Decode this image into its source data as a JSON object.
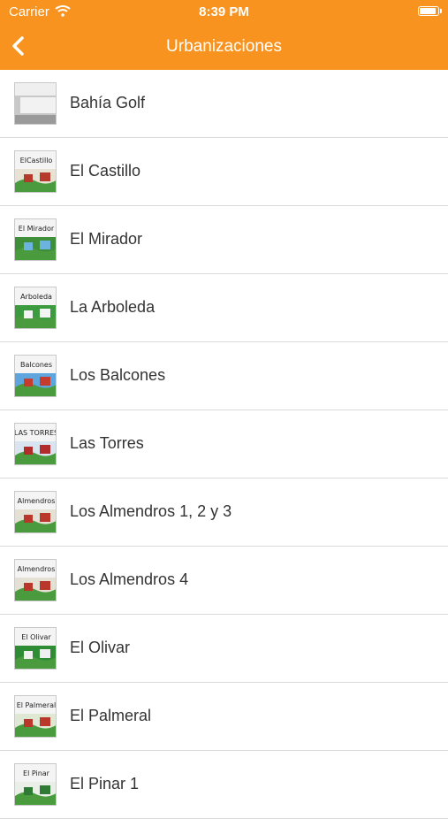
{
  "status_bar": {
    "carrier": "Carrier",
    "time": "8:39 PM"
  },
  "nav": {
    "title": "Urbanizaciones",
    "back_icon": "chevron-left-icon"
  },
  "colors": {
    "accent": "#f7931e",
    "separator": "#d9d9d9",
    "text": "#333333"
  },
  "items": [
    {
      "label": "Bahía Golf",
      "sign": "",
      "style": "photo"
    },
    {
      "label": "El Castillo",
      "sign": "ElCastillo",
      "style": "tile"
    },
    {
      "label": "El Mirador",
      "sign": "El Mirador",
      "style": "tile"
    },
    {
      "label": "La Arboleda",
      "sign": "Arboleda",
      "style": "tile"
    },
    {
      "label": "Los Balcones",
      "sign": "Balcones",
      "style": "tile"
    },
    {
      "label": "Las Torres",
      "sign": "LAS TORRES",
      "style": "tile"
    },
    {
      "label": "Los Almendros 1, 2 y 3",
      "sign": "Almendros",
      "style": "tile"
    },
    {
      "label": "Los Almendros 4",
      "sign": "Almendros",
      "style": "tile"
    },
    {
      "label": "El Olivar",
      "sign": "El Olivar",
      "style": "tile"
    },
    {
      "label": "El Palmeral",
      "sign": "El Palmeral",
      "style": "tile"
    },
    {
      "label": "El Pinar 1",
      "sign": "El Pinar",
      "style": "tile"
    }
  ]
}
